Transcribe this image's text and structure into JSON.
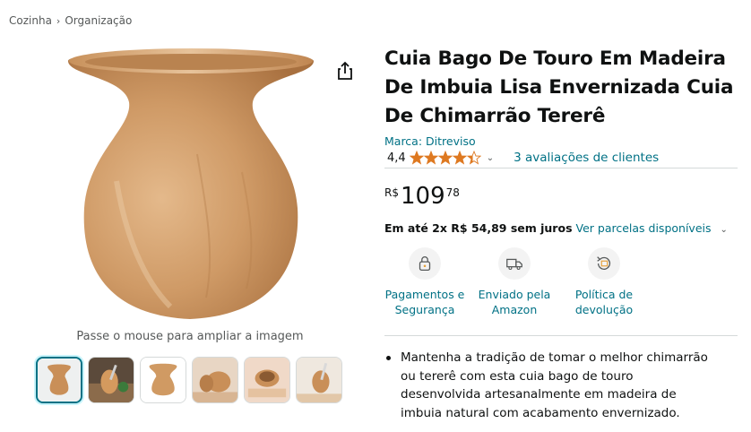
{
  "breadcrumb": {
    "items": [
      "Cozinha",
      "Organização"
    ],
    "separator": "›"
  },
  "product": {
    "title": "Cuia Bago De Touro Em Madeira De Imbuia Lisa Envernizada Cuia De Chimarrão Tererê",
    "brand": "Marca: Ditreviso",
    "rating_value": "4,4",
    "rating_stars": 4.4,
    "reviews_link": "3 avaliações de clientes"
  },
  "price": {
    "currency": "R$",
    "whole": "109",
    "fraction": "78"
  },
  "installments": {
    "bold": "Em até 2x R$ 54,89 sem juros",
    "link": "Ver parcelas disponíveis"
  },
  "features": [
    {
      "icon": "lock-icon",
      "label": "Pagamentos e Segurança"
    },
    {
      "icon": "truck-icon",
      "label": "Enviado pela Amazon"
    },
    {
      "icon": "return-icon",
      "label": "Política de devolução"
    }
  ],
  "gallery": {
    "hover_hint": "Passe o mouse para ampliar a imagem",
    "thumbnail_count": 6
  },
  "bullets": [
    "Mantenha a tradição de tomar o melhor chimarrão ou tererê com esta cuia bago de touro desenvolvida artesanalmente em madeira de imbuia natural com acabamento envernizado."
  ],
  "colors": {
    "link": "#007185",
    "star": "#de7921",
    "text": "#0f1111",
    "muted": "#565959"
  }
}
